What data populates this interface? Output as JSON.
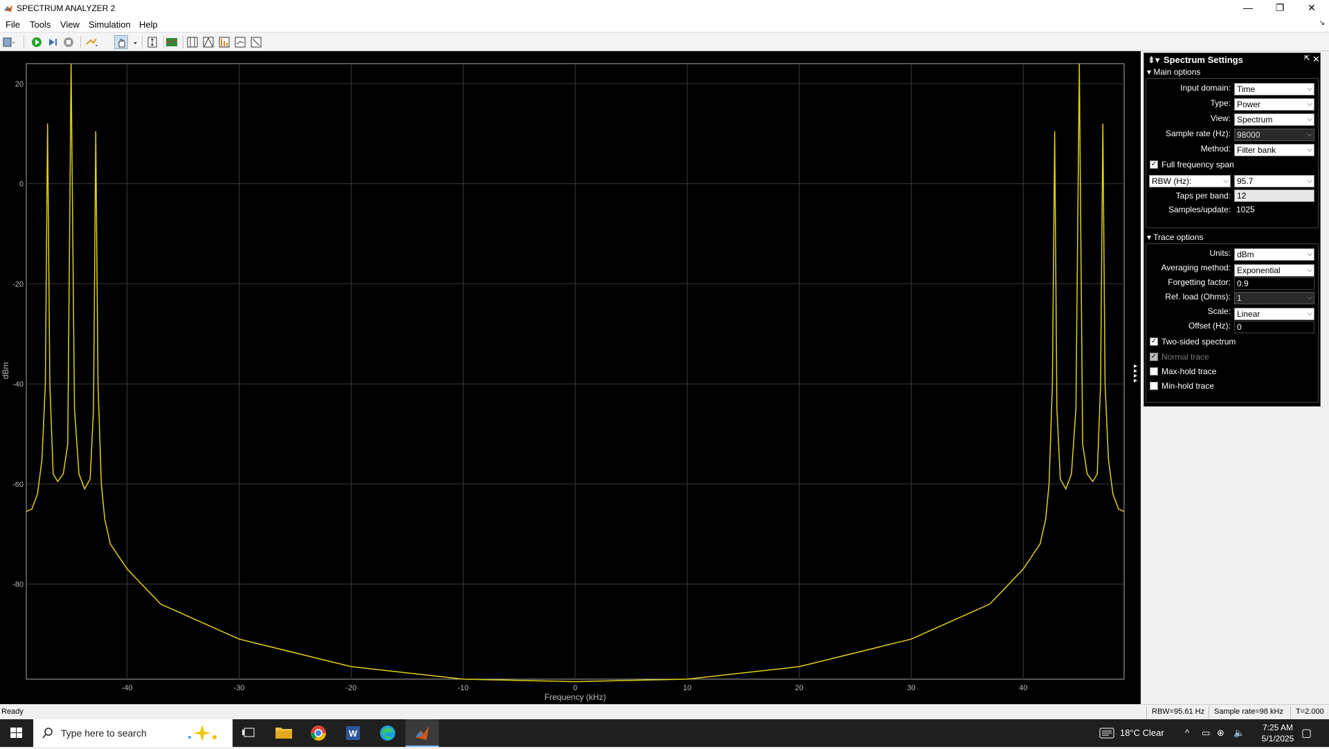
{
  "window": {
    "title": "SPECTRUM ANALYZER 2",
    "minimize": "—",
    "restore": "❐",
    "close": "✕"
  },
  "menu": {
    "items": [
      "File",
      "Tools",
      "View",
      "Simulation",
      "Help"
    ]
  },
  "plot": {
    "ylabel": "dBm",
    "xlabel": "Frequency (kHz)",
    "xticks": [
      "-40",
      "-30",
      "-20",
      "-10",
      "0",
      "10",
      "20",
      "30",
      "40"
    ],
    "yticks": [
      "20",
      "0",
      "-20",
      "-40",
      "-60",
      "-80"
    ]
  },
  "chart_data": {
    "type": "line",
    "xlabel": "Frequency (kHz)",
    "ylabel": "dBm",
    "xlim": [
      -49,
      49
    ],
    "ylim": [
      -99,
      24
    ],
    "grid": true,
    "series": [
      {
        "color": "#e0d21a",
        "x": [
          -49,
          -48.5,
          -48,
          -47.6,
          -47.3,
          -47.1,
          -46.9,
          -46.6,
          -46.2,
          -45.7,
          -45.3,
          -45,
          -44.7,
          -44.3,
          -43.8,
          -43.3,
          -43,
          -42.8,
          -42.6,
          -42.3,
          -42,
          -41.5,
          -40,
          -37,
          -30,
          -20,
          -10,
          0,
          10,
          20,
          30,
          37,
          40,
          41.5,
          42,
          42.3,
          42.6,
          42.8,
          43,
          43.3,
          43.8,
          44.3,
          44.7,
          45,
          45.3,
          45.7,
          46.2,
          46.6,
          46.9,
          47.1,
          47.3,
          47.6,
          48,
          48.5,
          49
        ],
        "y": [
          -65.5,
          -65,
          -62,
          -55,
          -40,
          12,
          -40,
          -58,
          -59.5,
          -58,
          -52,
          24,
          -45,
          -58,
          -61,
          -59,
          -45,
          10.5,
          -40,
          -60,
          -67,
          -72,
          -77,
          -84,
          -91,
          -96.5,
          -99,
          -99.5,
          -99,
          -96.5,
          -91,
          -84,
          -77,
          -72,
          -67,
          -60,
          -40,
          10.5,
          -45,
          -59,
          -61,
          -58,
          -45,
          24,
          -52,
          -58,
          -59.5,
          -58,
          -40,
          12,
          -40,
          -55,
          -62,
          -65,
          -65.5
        ]
      }
    ]
  },
  "panel": {
    "title": "Spectrum Settings",
    "main_options": {
      "heading": "Main options",
      "input_domain_label": "Input domain:",
      "input_domain": "Time",
      "type_label": "Type:",
      "type": "Power",
      "view_label": "View:",
      "view": "Spectrum",
      "sample_rate_label": "Sample rate (Hz):",
      "sample_rate": "98000",
      "method_label": "Method:",
      "method": "Filter bank",
      "full_span_label": "Full frequency span",
      "rbw_label": "RBW (Hz):",
      "rbw": "95.7",
      "taps_label": "Taps per band:",
      "taps": "12",
      "samples_label": "Samples/update:",
      "samples": "1025"
    },
    "trace_options": {
      "heading": "Trace options",
      "units_label": "Units:",
      "units": "dBm",
      "avg_label": "Averaging method:",
      "avg": "Exponential",
      "forget_label": "Forgetting factor:",
      "forget": "0.9",
      "refload_label": "Ref. load (Ohms):",
      "refload": "1",
      "scale_label": "Scale:",
      "scale": "Linear",
      "offset_label": "Offset (Hz):",
      "offset": "0",
      "two_sided_label": "Two-sided spectrum",
      "normal_label": "Normal trace",
      "maxhold_label": "Max-hold trace",
      "minhold_label": "Min-hold trace"
    }
  },
  "status": {
    "left": "Ready",
    "rbw": "RBW=95.61 Hz",
    "fs": "Sample rate=98 kHz",
    "t": "T=2.000"
  },
  "taskbar": {
    "search_placeholder": "Type here to search",
    "weather": "18°C  Clear",
    "time": "7:25 AM",
    "date": "5/1/2025"
  }
}
